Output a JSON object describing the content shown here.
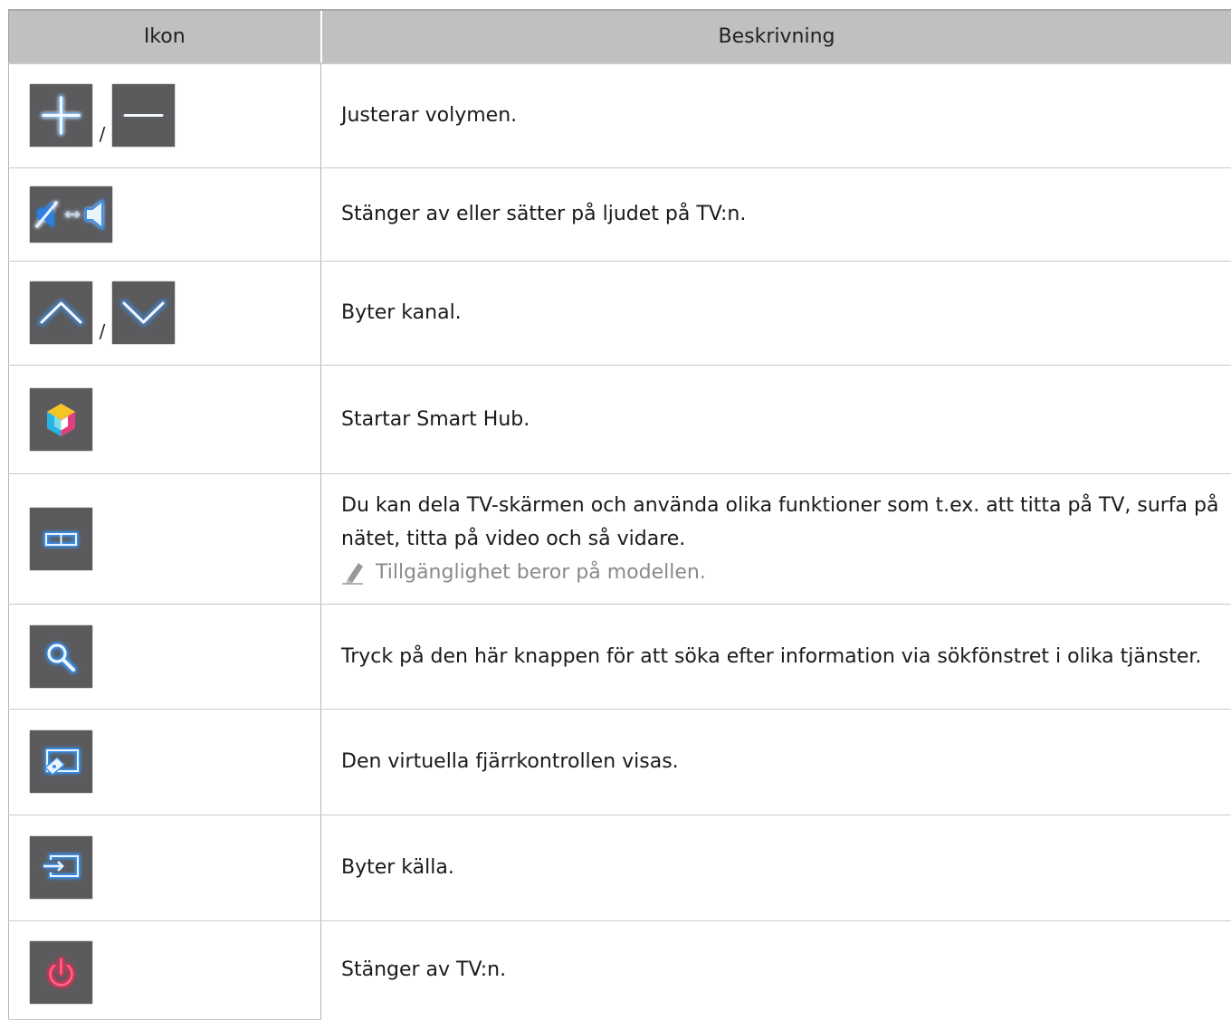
{
  "table": {
    "headers": {
      "icon": "Ikon",
      "description": "Beskrivning"
    },
    "separator": "/",
    "rows": [
      {
        "icons": [
          "plus-icon",
          "minus-icon"
        ],
        "description": "Justerar volymen."
      },
      {
        "icons": [
          "mute-toggle-icon"
        ],
        "description": "Stänger av eller sätter på ljudet på TV:n."
      },
      {
        "icons": [
          "chevron-up-icon",
          "chevron-down-icon"
        ],
        "description": "Byter kanal."
      },
      {
        "icons": [
          "smart-hub-icon"
        ],
        "description": "Startar Smart Hub."
      },
      {
        "icons": [
          "split-screen-icon"
        ],
        "description": "Du kan dela TV-skärmen och använda olika funktioner som t.ex. att titta på TV, surfa på nätet, titta på video och så vidare.",
        "note": "Tillgänglighet beror på modellen."
      },
      {
        "icons": [
          "search-icon"
        ],
        "description": "Tryck på den här knappen för att söka efter information via sökfönstret i olika tjänster."
      },
      {
        "icons": [
          "virtual-remote-icon"
        ],
        "description": "Den virtuella fjärrkontrollen visas."
      },
      {
        "icons": [
          "source-icon"
        ],
        "description": "Byter källa."
      },
      {
        "icons": [
          "power-icon"
        ],
        "description": "Stänger av TV:n."
      }
    ]
  },
  "colors": {
    "button_bg": "#5b5b5d",
    "icon_blue": "#3d8fe8",
    "power_red": "#e8325a",
    "header_bg": "#bfc0c2"
  }
}
